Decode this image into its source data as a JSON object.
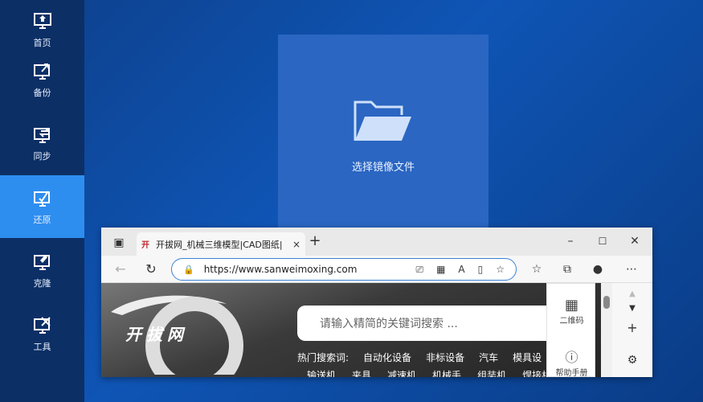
{
  "sidebar": {
    "items": [
      {
        "label": "首页",
        "icon": "home-monitor-icon"
      },
      {
        "label": "备份",
        "icon": "backup-icon"
      },
      {
        "label": "同步",
        "icon": "sync-icon"
      },
      {
        "label": "还原",
        "icon": "restore-icon",
        "active": true
      },
      {
        "label": "克隆",
        "icon": "clone-icon"
      },
      {
        "label": "工具",
        "icon": "tools-icon"
      }
    ]
  },
  "select_panel": {
    "label": "选择镜像文件",
    "icon": "folder-icon"
  },
  "browser": {
    "tab": {
      "favicon": "开",
      "title": "开拔网_机械三维模型|CAD图纸|",
      "close": "×"
    },
    "new_tab": "+",
    "window_controls": {
      "minimize": "–",
      "maximize": "☐",
      "close": "✕"
    },
    "back": "←",
    "refresh": "↻",
    "url": "https://www.sanweimoxing.com",
    "site": {
      "logo_text": "开拔网",
      "search_placeholder": "请输入精简的关键词搜索 ...",
      "hot_label": "热门搜索词:",
      "hot_terms": [
        "自动化设备",
        "非标设备",
        "汽车",
        "模具设"
      ],
      "hot_terms_row2": [
        "输送机",
        "夹具",
        "减速机",
        "机械手",
        "组装机",
        "焊接机"
      ],
      "float_panel": [
        {
          "label": "二维码",
          "icon": "qrcode-icon"
        },
        {
          "label": "帮助手册",
          "icon": "help-icon"
        }
      ]
    }
  },
  "colors": {
    "sidebar_bg": "#0c2f66",
    "active": "#2e8ef0",
    "desktop_bg": "#0f55b5"
  }
}
